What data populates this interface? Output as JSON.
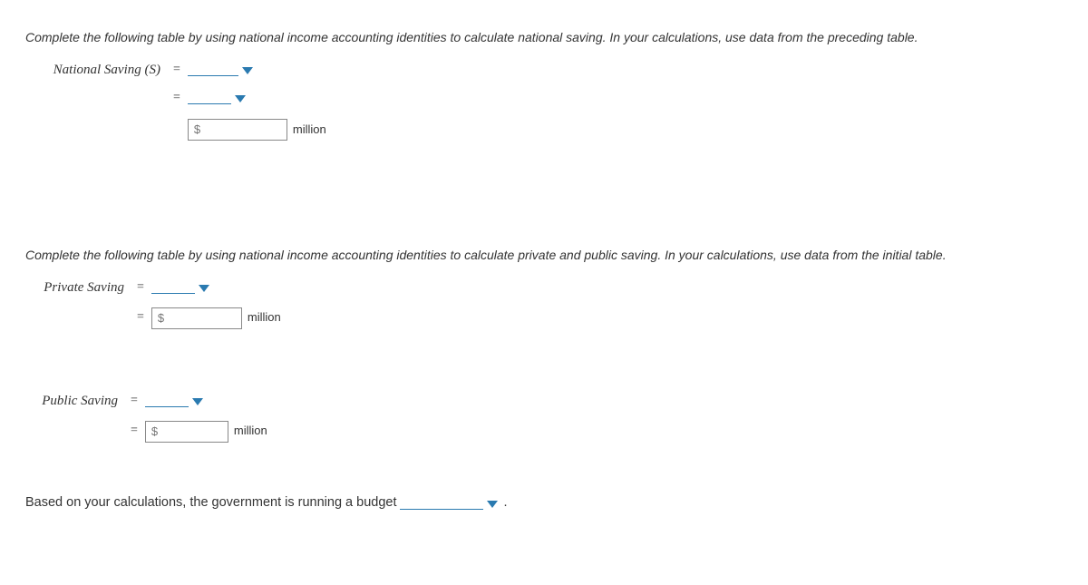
{
  "section1": {
    "instruction": "Complete the following table by using national income accounting identities to calculate national saving. In your calculations, use data from the preceding table.",
    "label": "National Saving (S)",
    "equals": "=",
    "input_prefix": "$",
    "unit": "million"
  },
  "section2": {
    "instruction": "Complete the following table by using national income accounting identities to calculate private and public saving. In your calculations, use data from the initial table.",
    "private_label": "Private Saving",
    "public_label": "Public Saving",
    "equals": "=",
    "input_prefix": "$",
    "unit": "million"
  },
  "final": {
    "text_before": "Based on your calculations, the government is running a budget ",
    "period": "."
  }
}
